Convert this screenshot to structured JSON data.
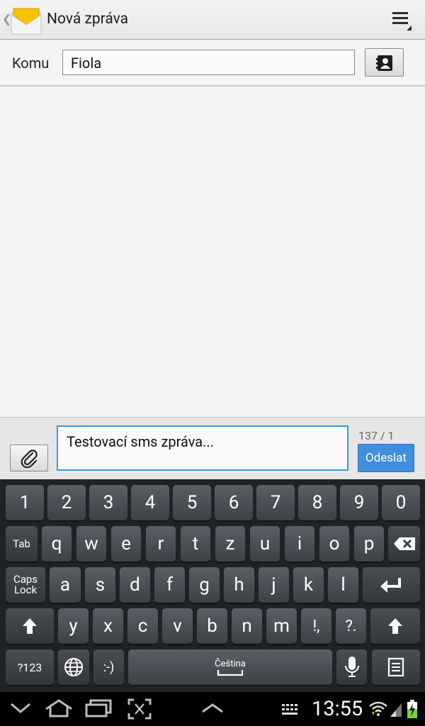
{
  "header": {
    "title": "Nová zpráva",
    "icons": [
      "back-caret-icon",
      "message-envelope-icon",
      "overflow-menu-icon"
    ]
  },
  "recipient": {
    "label": "Komu",
    "value": "Fiola",
    "icons": [
      "contact-book-icon"
    ]
  },
  "compose": {
    "text": "Testovací sms zpráva...",
    "counter": "137 / 1",
    "send_label": "Odeslat",
    "input_border_color": "#3a9ad9",
    "send_color": "#3f8fde",
    "icons": [
      "paperclip-icon"
    ]
  },
  "keyboard": {
    "number_row": [
      "1",
      "2",
      "3",
      "4",
      "5",
      "6",
      "7",
      "8",
      "9",
      "0"
    ],
    "row_q": [
      "q",
      "w",
      "e",
      "r",
      "t",
      "z",
      "u",
      "i",
      "o",
      "p"
    ],
    "row_a": [
      "a",
      "s",
      "d",
      "f",
      "g",
      "h",
      "j",
      "k",
      "l"
    ],
    "row_y": [
      "y",
      "x",
      "c",
      "v",
      "b",
      "n",
      "m",
      "!,",
      "?."
    ],
    "tab_label": "Tab",
    "caps_label_1": "Caps",
    "caps_label_2": "Lock",
    "sym_label": "?123",
    "emoticon_label": ":-)",
    "space_label": "Čeština",
    "icons": [
      "backspace-icon",
      "enter-icon",
      "shift-icon",
      "globe-icon",
      "microphone-icon",
      "clipboard-icon"
    ]
  },
  "statusbar": {
    "time": "13:55",
    "icons": [
      "hide-keyboard-icon",
      "home-icon",
      "recent-apps-icon",
      "screenshot-icon",
      "menu-up-icon",
      "keyboard-icon",
      "wifi-icon",
      "signal-icon",
      "battery-charging-icon"
    ]
  }
}
